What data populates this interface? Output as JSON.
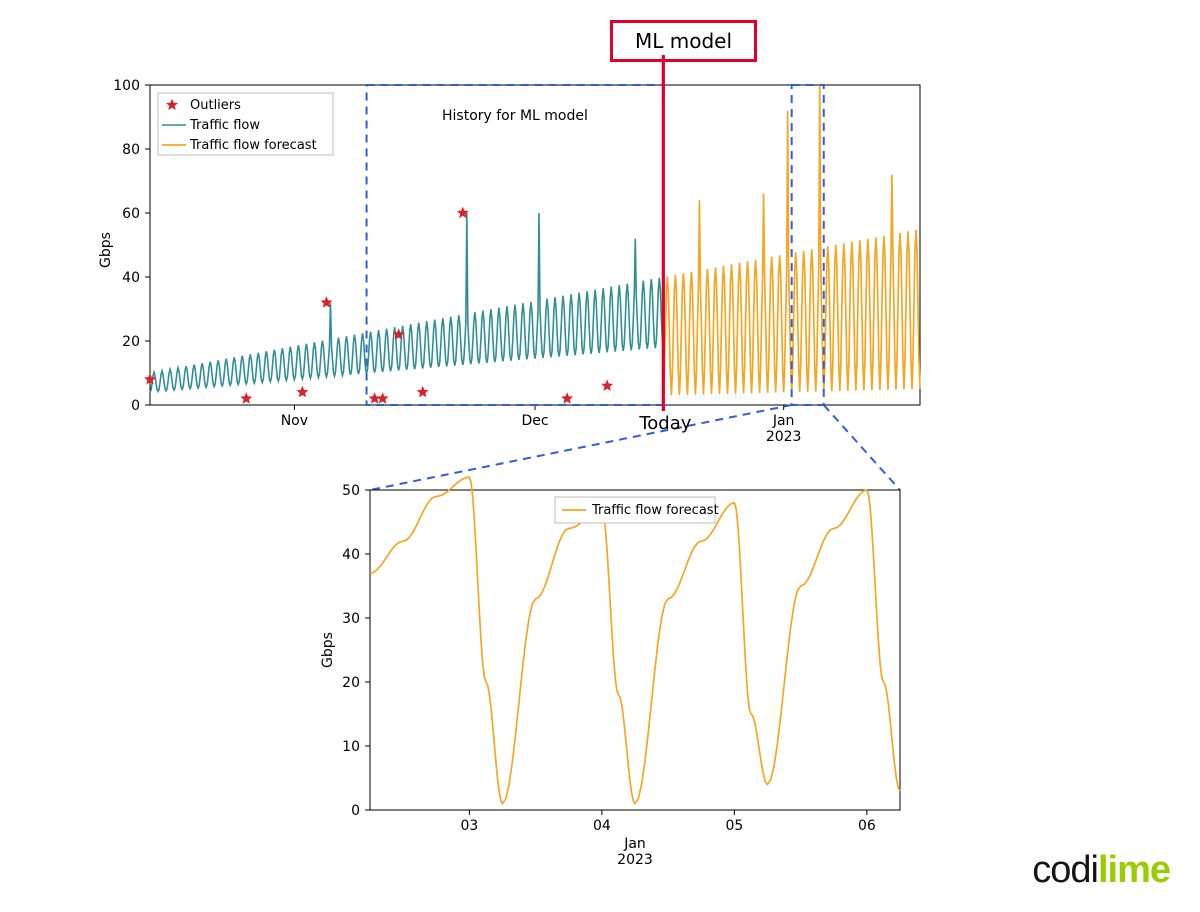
{
  "annotations": {
    "ml_box": "ML model",
    "history_label": "History for ML model",
    "today_label": "Today"
  },
  "logo": {
    "part1": "codi",
    "part2": "lime"
  },
  "chart_data": [
    {
      "type": "line",
      "title": "",
      "xlabel": "",
      "ylabel": "Gbps",
      "ylim": [
        0,
        100
      ],
      "yticks": [
        0,
        20,
        40,
        60,
        80,
        100
      ],
      "xticks": [
        "Nov",
        "Dec",
        "Jan\n2023"
      ],
      "x_range_days": [
        "2022-10-14",
        "2023-01-18"
      ],
      "vlines": [
        {
          "x": "2022-12-17",
          "label": "Today"
        }
      ],
      "regions": [
        {
          "name": "history_for_ml",
          "x0": "2022-11-10",
          "x1": "2022-12-17",
          "label": "History for ML model"
        },
        {
          "name": "zoom_window",
          "x0": "2023-01-02",
          "x1": "2023-01-06"
        }
      ],
      "legend": [
        {
          "name": "Outliers",
          "marker": "star",
          "color": "#d8232a"
        },
        {
          "name": "Traffic flow",
          "line": true,
          "color": "#2f8f94"
        },
        {
          "name": "Traffic flow forecast",
          "line": true,
          "color": "#f5a623"
        }
      ],
      "series": [
        {
          "name": "Traffic flow",
          "color": "#2f8f94",
          "domain": [
            "2022-10-14",
            "2022-12-17"
          ],
          "representation": "daily_oscillation",
          "baseline_start": 4,
          "baseline_end": 18,
          "peak_start": 10,
          "peak_end": 40,
          "notable_spikes": [
            {
              "date": "2022-11-05",
              "value": 32
            },
            {
              "date": "2022-11-22",
              "value": 60
            },
            {
              "date": "2022-12-01",
              "value": 60
            },
            {
              "date": "2022-12-13",
              "value": 52
            }
          ]
        },
        {
          "name": "Traffic flow forecast",
          "color": "#f5a623",
          "domain": [
            "2022-12-17",
            "2023-01-18"
          ],
          "representation": "daily_oscillation",
          "baseline_start": 3,
          "baseline_end": 5,
          "peak_start": 40,
          "peak_end": 55,
          "notable_spikes": [
            {
              "date": "2022-12-21",
              "value": 64
            },
            {
              "date": "2022-12-29",
              "value": 66
            },
            {
              "date": "2023-01-01",
              "value": 92
            },
            {
              "date": "2023-01-05",
              "value": 100
            },
            {
              "date": "2023-01-14",
              "value": 72
            }
          ]
        },
        {
          "name": "Outliers",
          "color": "#d8232a",
          "type": "scatter",
          "points": [
            {
              "date": "2022-10-14",
              "value": 8
            },
            {
              "date": "2022-10-26",
              "value": 2
            },
            {
              "date": "2022-11-02",
              "value": 4
            },
            {
              "date": "2022-11-05",
              "value": 32
            },
            {
              "date": "2022-11-11",
              "value": 2
            },
            {
              "date": "2022-11-12",
              "value": 2
            },
            {
              "date": "2022-11-14",
              "value": 22
            },
            {
              "date": "2022-11-17",
              "value": 4
            },
            {
              "date": "2022-11-22",
              "value": 60
            },
            {
              "date": "2022-12-05",
              "value": 2
            },
            {
              "date": "2022-12-10",
              "value": 6
            }
          ]
        }
      ]
    },
    {
      "type": "line",
      "title": "",
      "xlabel": "Jan\n2023",
      "ylabel": "Gbps",
      "ylim": [
        0,
        50
      ],
      "yticks": [
        0,
        10,
        20,
        30,
        40,
        50
      ],
      "xticks": [
        "03",
        "04",
        "05",
        "06"
      ],
      "x_domain": [
        "2023-01-02T06:00",
        "2023-01-06T06:00"
      ],
      "legend": [
        {
          "name": "Traffic flow forecast",
          "line": true,
          "color": "#f5a623"
        }
      ],
      "series": [
        {
          "name": "Traffic flow forecast",
          "color": "#f5a623",
          "x": [
            "02 06h",
            "02 12h",
            "02 18h",
            "03 00h",
            "03 03h",
            "03 06h",
            "03 12h",
            "03 18h",
            "04 00h",
            "04 03h",
            "04 06h",
            "04 12h",
            "04 18h",
            "05 00h",
            "05 03h",
            "05 06h",
            "05 12h",
            "05 18h",
            "06 00h",
            "06 03h",
            "06 06h"
          ],
          "y": [
            37,
            42,
            49,
            52,
            20,
            1,
            33,
            44,
            47,
            18,
            1,
            33,
            42,
            48,
            15,
            4,
            35,
            44,
            50,
            20,
            3
          ]
        }
      ]
    }
  ]
}
